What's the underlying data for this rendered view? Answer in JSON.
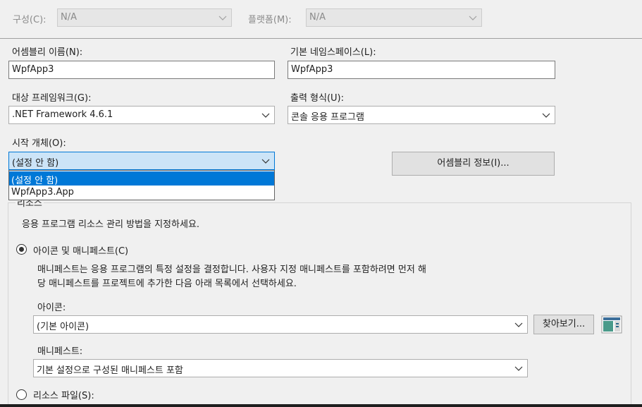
{
  "header": {
    "config_label": "구성(C):",
    "config_value": "N/A",
    "platform_label": "플랫폼(M):",
    "platform_value": "N/A"
  },
  "assembly": {
    "name_label": "어셈블리 이름(N):",
    "name_value": "WpfApp3",
    "namespace_label": "기본 네임스페이스(L):",
    "namespace_value": "WpfApp3"
  },
  "framework": {
    "label": "대상 프레임워크(G):",
    "value": ".NET Framework 4.6.1"
  },
  "output": {
    "label": "출력 형식(U):",
    "value": "콘솔 응용 프로그램"
  },
  "startup": {
    "label": "시작 개체(O):",
    "value": "(설정 안 함)",
    "options": [
      "(설정 안 함)",
      "WpfApp3.App"
    ]
  },
  "assembly_info_button": "어셈블리 정보(I)...",
  "resources": {
    "group_label": "리소스",
    "description": "응용 프로그램 리소스 관리 방법을 지정하세요.",
    "icon_manifest_radio": "아이콘 및 매니페스트(C)",
    "manifest_desc_line1": "매니페스트는 응용 프로그램의 특정 설정을 결정합니다. 사용자 지정 매니페스트를 포함하려면 먼저 해",
    "manifest_desc_line2": "당 매니페스트를 프로젝트에 추가한 다음 아래 목록에서 선택하세요.",
    "icon_label": "아이콘:",
    "icon_value": "(기본 아이콘)",
    "browse_button": "찾아보기...",
    "manifest_label": "매니페스트:",
    "manifest_value": "기본 설정으로 구성된 매니페스트 포함",
    "resource_file_radio": "리소스 파일(S):"
  }
}
